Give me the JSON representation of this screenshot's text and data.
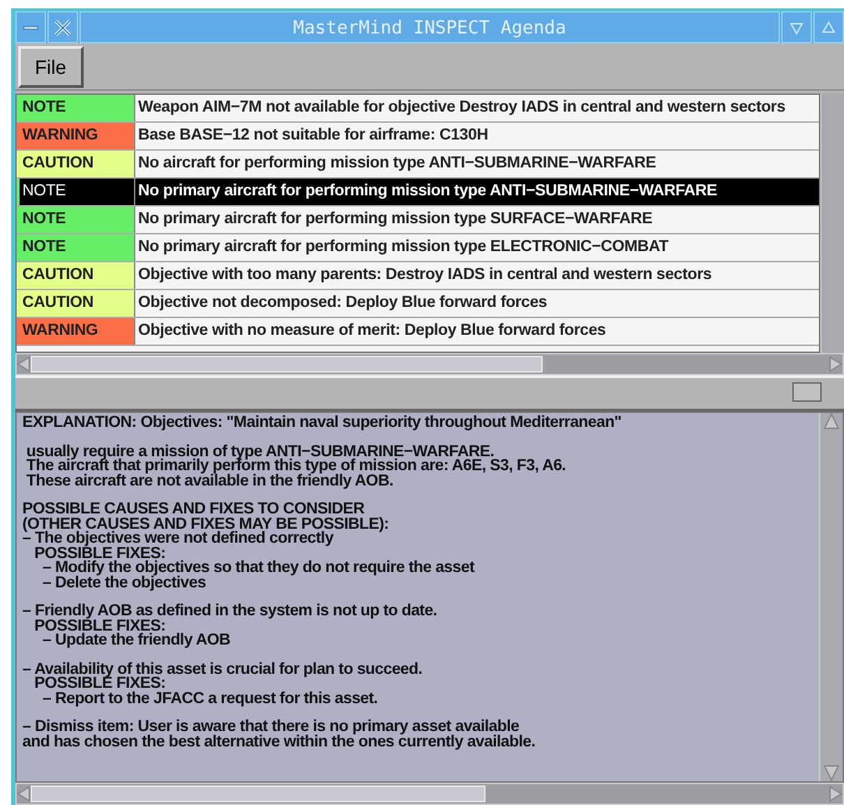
{
  "window": {
    "title": "MasterMind INSPECT Agenda"
  },
  "menu": [
    "File"
  ],
  "agenda": [
    {
      "kind": "note",
      "label": "NOTE",
      "message": "Weapon AIM−7M not available for objective Destroy IADS in central and western sectors",
      "selected": false
    },
    {
      "kind": "warning",
      "label": "WARNING",
      "message": "Base BASE−12 not suitable for airframe: C130H",
      "selected": false
    },
    {
      "kind": "caution",
      "label": "CAUTION",
      "message": "No aircraft for performing mission type ANTI−SUBMARINE−WARFARE",
      "selected": false
    },
    {
      "kind": "note",
      "label": "NOTE",
      "message": "No primary aircraft for performing mission type ANTI−SUBMARINE−WARFARE",
      "selected": true
    },
    {
      "kind": "note",
      "label": "NOTE",
      "message": "No primary aircraft for performing mission type SURFACE−WARFARE",
      "selected": false
    },
    {
      "kind": "note",
      "label": "NOTE",
      "message": "No primary aircraft for performing mission type ELECTRONIC−COMBAT",
      "selected": false
    },
    {
      "kind": "caution",
      "label": "CAUTION",
      "message": "Objective with too many parents: Destroy IADS in central and western sectors",
      "selected": false
    },
    {
      "kind": "caution",
      "label": "CAUTION",
      "message": "Objective not decomposed: Deploy Blue forward forces",
      "selected": false
    },
    {
      "kind": "warning",
      "label": "WARNING",
      "message": "Objective with no measure of merit: Deploy Blue forward forces",
      "selected": false
    }
  ],
  "explanation": [
    [
      "EXPLANATION: Objectives: \"Maintain naval superiority throughout Mediterranean\""
    ],
    [
      " usually require a mission of type ANTI−SUBMARINE−WARFARE.",
      " The aircraft that primarily perform this type of mission are: A6E, S3, F3, A6.",
      " These aircraft are not available in the friendly AOB."
    ],
    [
      "POSSIBLE CAUSES AND FIXES TO CONSIDER",
      "(OTHER CAUSES AND FIXES MAY BE POSSIBLE):",
      "– The objectives were not defined correctly",
      "   POSSIBLE FIXES:",
      "     – Modify the objectives so that they do not require the asset",
      "     – Delete the objectives"
    ],
    [
      "– Friendly AOB as defined in the system is not up to date.",
      "   POSSIBLE FIXES:",
      "     – Update the friendly AOB"
    ],
    [
      "– Availability of this asset is crucial for plan to succeed.",
      "   POSSIBLE FIXES:",
      "     – Report to the JFACC a request for this asset."
    ],
    [
      "– Dismiss item: User is aware that there is no primary asset available",
      "and has chosen the best alternative within the ones currently available."
    ]
  ]
}
